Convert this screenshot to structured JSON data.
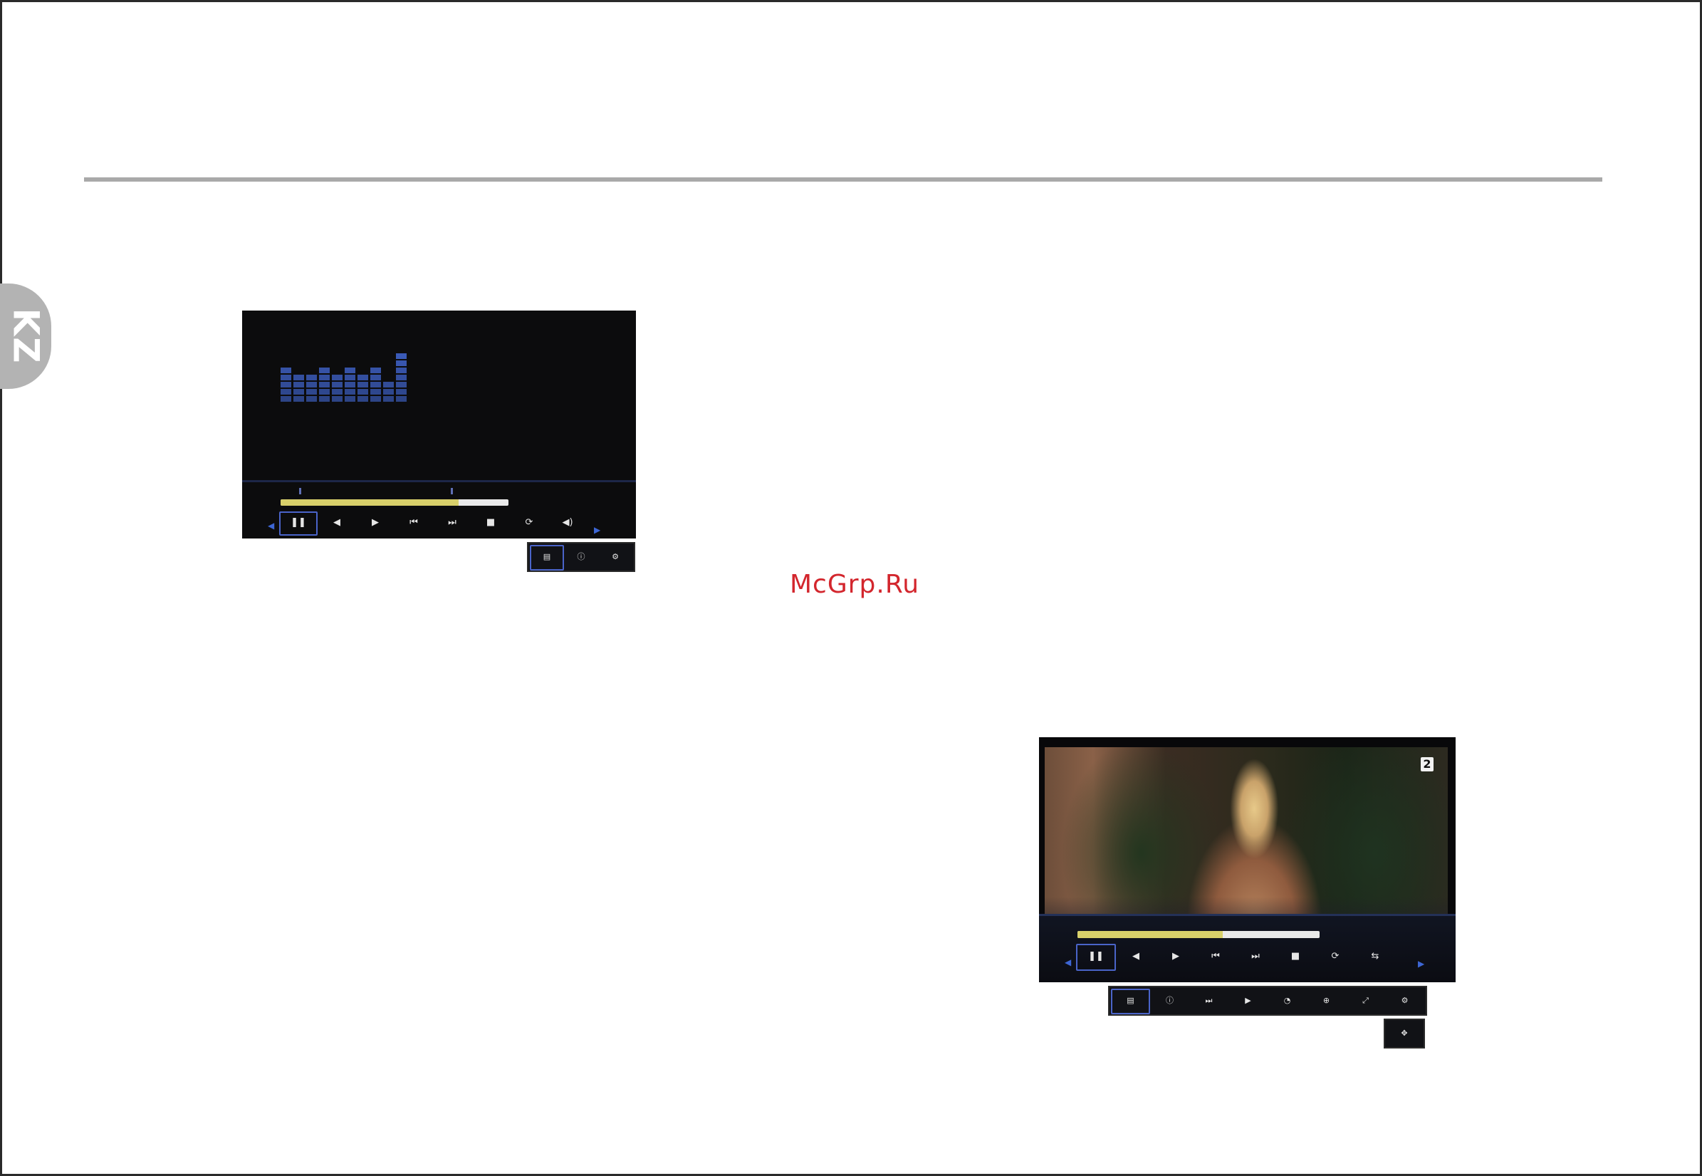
{
  "side_tab": {
    "label": "KZ"
  },
  "watermark": "McGrp.Ru",
  "music_player": {
    "spectrum_levels": [
      5,
      4,
      4,
      5,
      4,
      5,
      4,
      5,
      3,
      7
    ],
    "track_name": "",
    "progress": 0.78,
    "time": "",
    "controls": [
      {
        "icon": "pause-icon",
        "glyph": "❚❚",
        "label": ""
      },
      {
        "icon": "rewind-icon",
        "glyph": "◀",
        "label": ""
      },
      {
        "icon": "forward-icon",
        "glyph": "▶",
        "label": ""
      },
      {
        "icon": "previous-icon",
        "glyph": "⏮",
        "label": ""
      },
      {
        "icon": "next-icon",
        "glyph": "⏭",
        "label": ""
      },
      {
        "icon": "stop-icon",
        "glyph": "■",
        "label": ""
      },
      {
        "icon": "repeat-icon",
        "glyph": "⟳",
        "label": ""
      },
      {
        "icon": "volume-icon",
        "glyph": "◀)",
        "label": ""
      }
    ],
    "options": [
      {
        "icon": "list-icon",
        "glyph": "▤",
        "label": ""
      },
      {
        "icon": "info-icon",
        "glyph": "ⓘ",
        "label": ""
      },
      {
        "icon": "settings-icon",
        "glyph": "⚙",
        "label": ""
      }
    ],
    "colors": {
      "spectrum": "#3f62c8",
      "progress": "#d8d06a",
      "selection": "#4a64c9"
    }
  },
  "video_player": {
    "channel_logo": "2",
    "progress": 0.6,
    "time": "",
    "controls": [
      {
        "icon": "pause-icon",
        "glyph": "❚❚",
        "label": ""
      },
      {
        "icon": "rewind-icon",
        "glyph": "◀",
        "label": ""
      },
      {
        "icon": "forward-icon",
        "glyph": "▶",
        "label": ""
      },
      {
        "icon": "previous-icon",
        "glyph": "⏮",
        "label": ""
      },
      {
        "icon": "next-icon",
        "glyph": "⏭",
        "label": ""
      },
      {
        "icon": "stop-icon",
        "glyph": "■",
        "label": ""
      },
      {
        "icon": "repeat-icon",
        "glyph": "⟳",
        "label": ""
      },
      {
        "icon": "subtitle-icon",
        "glyph": "⇆",
        "label": ""
      }
    ],
    "options": [
      {
        "icon": "list-icon",
        "glyph": "▤",
        "label": ""
      },
      {
        "icon": "info-icon",
        "glyph": "ⓘ",
        "label": ""
      },
      {
        "icon": "slow-motion-icon",
        "glyph": "⏭",
        "label": ""
      },
      {
        "icon": "step-play-icon",
        "glyph": "▶",
        "label": ""
      },
      {
        "icon": "goto-time-icon",
        "glyph": "◔",
        "label": ""
      },
      {
        "icon": "zoom-in-icon",
        "glyph": "⊕",
        "label": ""
      },
      {
        "icon": "aspect-ratio-icon",
        "glyph": "⤢",
        "label": ""
      },
      {
        "icon": "settings-icon",
        "glyph": "⚙",
        "label": ""
      }
    ],
    "move_view": {
      "icon": "move-view-icon",
      "glyph": "✥",
      "label": ""
    },
    "colors": {
      "progress": "#d8d06a",
      "selection": "#4a64c9"
    }
  }
}
